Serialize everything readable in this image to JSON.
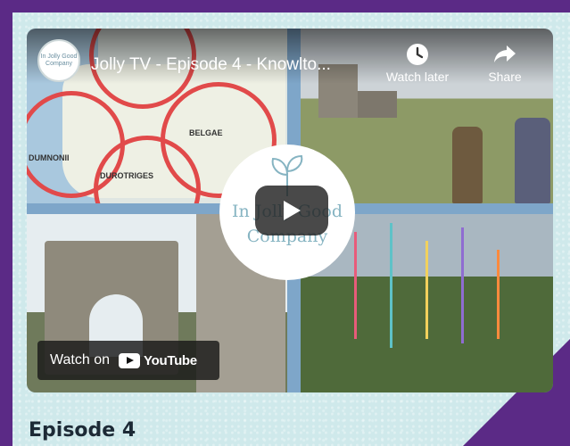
{
  "channel": {
    "avatar_text": "In Jolly Good Company"
  },
  "video": {
    "title": "Jolly TV - Episode 4 - Knowlto..."
  },
  "controls": {
    "watch_later": "Watch later",
    "share": "Share"
  },
  "logo": {
    "line1": "In Jolly Good",
    "line2": "Company"
  },
  "map": {
    "labels": [
      "BELGAE",
      "DUMNONII",
      "DUROTRIGES"
    ]
  },
  "youtube": {
    "watch_on": "Watch on",
    "brand": "YouTube"
  },
  "episode": {
    "heading": "Episode 4"
  },
  "colors": {
    "frame": "#5b2a86",
    "card": "#cfe9eb",
    "map_ring": "#e14a4a",
    "logo_text": "#86b4c2"
  }
}
